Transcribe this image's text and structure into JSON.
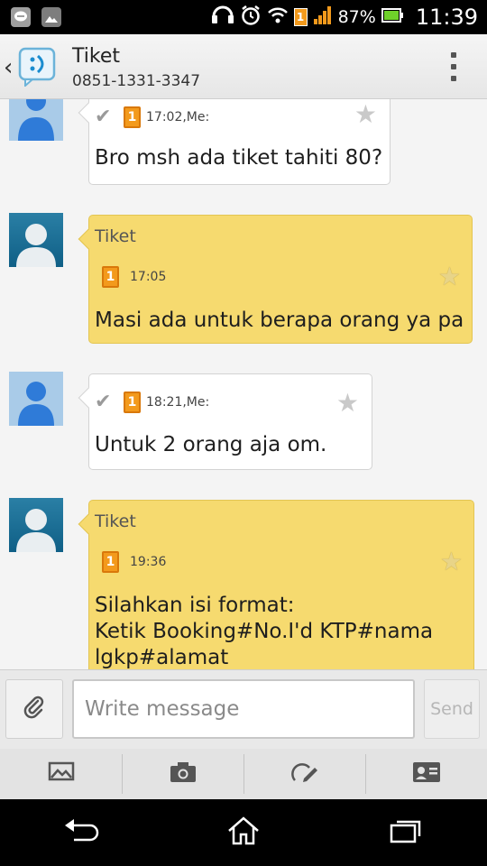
{
  "status_bar": {
    "battery_percent": "87%",
    "time": "11:39",
    "sim_badge": "1"
  },
  "header": {
    "title": "Tiket",
    "phone": "0851-1331-3347"
  },
  "messages": [
    {
      "direction": "out",
      "sim": "1",
      "time": "17:02,Me:",
      "text": "Bro msh ada tiket tahiti 80?"
    },
    {
      "direction": "in",
      "sender": "Tiket",
      "sim": "1",
      "time": "17:05",
      "text": "Masi ada untuk berapa orang ya pa"
    },
    {
      "direction": "out",
      "sim": "1",
      "time": "18:21,Me:",
      "text": "Untuk 2 orang aja om."
    },
    {
      "direction": "in",
      "sender": "Tiket",
      "sim": "1",
      "time": "19:36",
      "text": "Silahkan isi format:\nKetik Booking#No.I'd KTP#nama lgkp#alamat"
    }
  ],
  "compose": {
    "placeholder": "Write message",
    "send_label": "Send"
  },
  "colors": {
    "incoming_bubble": "#f6da6f",
    "outgoing_bubble": "#ffffff",
    "sim_orange": "#f39a1c"
  }
}
